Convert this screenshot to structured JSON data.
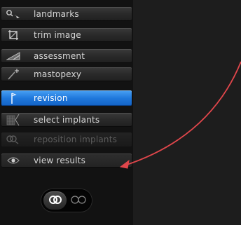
{
  "menu": {
    "items": [
      {
        "label": "landmarks",
        "icon": "landmarks-pin-icon",
        "state": "normal"
      },
      {
        "label": "trim image",
        "icon": "crop-icon",
        "state": "normal"
      },
      {
        "label": "assessment",
        "icon": "ruler-triangle-icon",
        "state": "normal"
      },
      {
        "label": "mastopexy",
        "icon": "scalpel-sparkle-icon",
        "state": "normal"
      },
      {
        "label": "revision",
        "icon": "revision-tool-icon",
        "state": "active"
      },
      {
        "label": "select implants",
        "icon": "implants-grid-icon",
        "state": "normal"
      },
      {
        "label": "reposition implants",
        "icon": "reposition-icon",
        "state": "disabled"
      },
      {
        "label": "view results",
        "icon": "eye-icon",
        "state": "normal"
      }
    ]
  },
  "toggle": {
    "left_icon": "double-circle-filled-icon",
    "right_icon": "double-circle-outline-icon",
    "selected": "left"
  },
  "colors": {
    "active_blue": "#1f78dc",
    "arrow_red": "#e0464b",
    "background": "#1b1b1b"
  }
}
